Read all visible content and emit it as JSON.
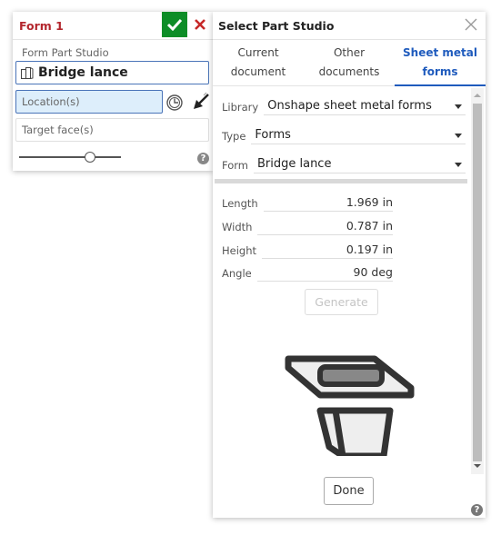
{
  "feature": {
    "title": "Form 1",
    "ok_icon": "checkmark-icon",
    "cancel_icon": "x-icon",
    "studio_label": "Form Part Studio",
    "studio_value": "Bridge lance",
    "location_placeholder": "Location(s)",
    "target_placeholder": "Target face(s)",
    "slider_value": 0.72,
    "help_label": "?"
  },
  "dialog": {
    "title": "Select Part Studio",
    "tabs": [
      {
        "line1": "Current",
        "line2": "document",
        "active": false
      },
      {
        "line1": "Other",
        "line2": "documents",
        "active": false
      },
      {
        "line1": "Sheet metal",
        "line2": "forms",
        "active": true
      }
    ],
    "selects": [
      {
        "label": "Library",
        "value": "Onshape sheet metal forms"
      },
      {
        "label": "Type",
        "value": "Forms"
      },
      {
        "label": "Form",
        "value": "Bridge lance"
      }
    ],
    "params": [
      {
        "label": "Length",
        "value": "1.969 in"
      },
      {
        "label": "Width",
        "value": "0.787 in"
      },
      {
        "label": "Height",
        "value": "0.197 in"
      },
      {
        "label": "Angle",
        "value": "90 deg"
      }
    ],
    "generate_label": "Generate",
    "done_label": "Done",
    "help_label": "?"
  },
  "colors": {
    "accent": "#1f5bbd",
    "title_red": "#b3262d",
    "ok_green": "#0d8d27",
    "field_focus_bg": "#ddeefb"
  }
}
